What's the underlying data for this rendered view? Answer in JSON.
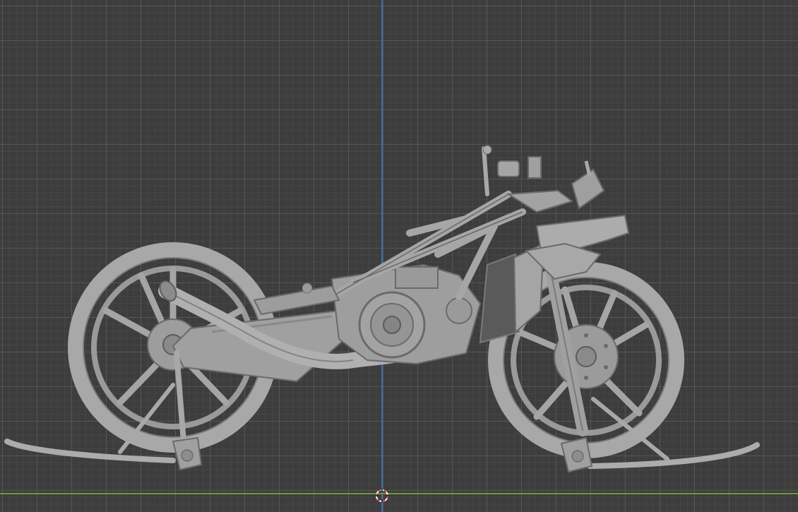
{
  "viewport": {
    "background_color": "#3d3d3d",
    "grid_major_color": "#646464",
    "grid_minor_color": "#505050",
    "axis_z_color": "#3b6fb0",
    "axis_x_color": "#6e9a36",
    "model_color": "#a9a9a9",
    "model_shade_color": "#7a7a7a",
    "model_dark_color": "#595959",
    "object": "motorcycle-model",
    "cursor_icon": "3d-cursor-icon"
  }
}
